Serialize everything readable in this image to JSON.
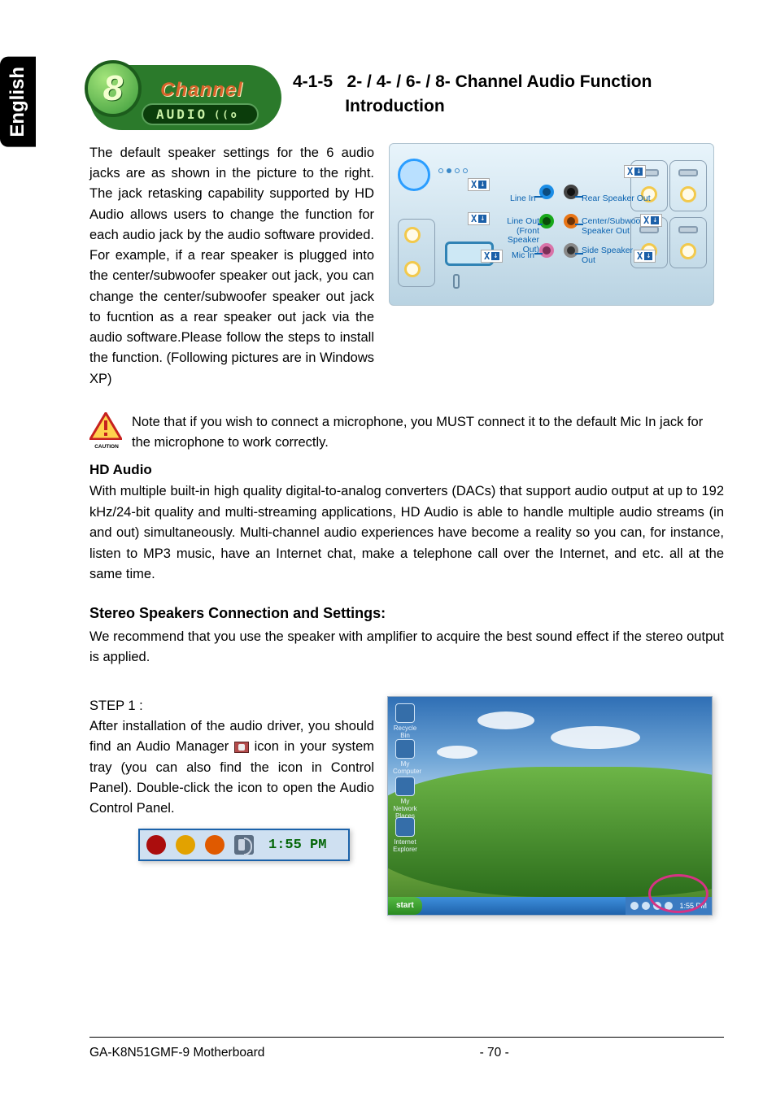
{
  "lang_tab": "English",
  "header": {
    "logo_channel": "Channel",
    "logo_audio": "AUDIO",
    "logo_number": "8",
    "section_no": "4-1-5",
    "title_line1": "2- / 4- / 6- / 8- Channel Audio Function",
    "title_line2": "Introduction"
  },
  "intro_para": "The default speaker settings for the 6 audio jacks are as shown in the picture to the right. The jack retasking capability supported by HD Audio allows users to change the function for each audio jack by the audio software provided. For example, if  a rear speaker is plugged into the center/subwoofer speaker out jack, you can change the center/subwoofer speaker out jack to fucntion as a rear speaker out jack via the audio software.Please follow the steps to install the function. (Following pictures are in Windows XP)",
  "panel": {
    "line_in": "Line In",
    "line_out1": "Line Out",
    "line_out2": "(Front Speaker Out)",
    "mic_in": "Mic In",
    "rear_out": "Rear Speaker Out",
    "center_out1": "Center/Subwoofer",
    "center_out2": "Speaker Out",
    "side_out1": "Side Speaker",
    "side_out2": "Out",
    "callout_x": "X"
  },
  "caution": "Note that if you wish to connect a microphone, you MUST connect it to the default Mic In jack for the microphone to work correctly.",
  "caution_label": "CAUTION",
  "hd_head": "HD Audio",
  "hd_para": "With multiple built-in high quality digital-to-analog converters (DACs) that support audio output at up to 192 kHz/24-bit quality and multi-streaming applications, HD Audio is able to handle multiple audio streams (in and out) simultaneously. Multi-channel audio experiences have become a reality so you can, for instance,  listen to MP3 music, have an Internet chat, make a telephone call over the Internet, and etc. all at the same time.",
  "stereo_head": "Stereo Speakers Connection and Settings:",
  "stereo_para": "We recommend that you use the speaker with amplifier to acquire the best sound effect if the stereo output is applied.",
  "step1_label": "STEP 1 :",
  "step1_before": "After installation of the audio driver, you should find an Audio Manager",
  "step1_after": "icon in your system tray (you can also find the icon in Control Panel).  Double-click the icon to open the Audio Control Panel.",
  "systray_time": "1:55 PM",
  "desktop": {
    "start": "start",
    "time": "1:55 PM",
    "icon1": "Recycle Bin",
    "icon2": "My Computer",
    "icon3": "My Network Places",
    "icon4": "Internet Explorer"
  },
  "footer": {
    "model": "GA-K8N51GMF-9 Motherboard",
    "page": "- 70 -"
  }
}
